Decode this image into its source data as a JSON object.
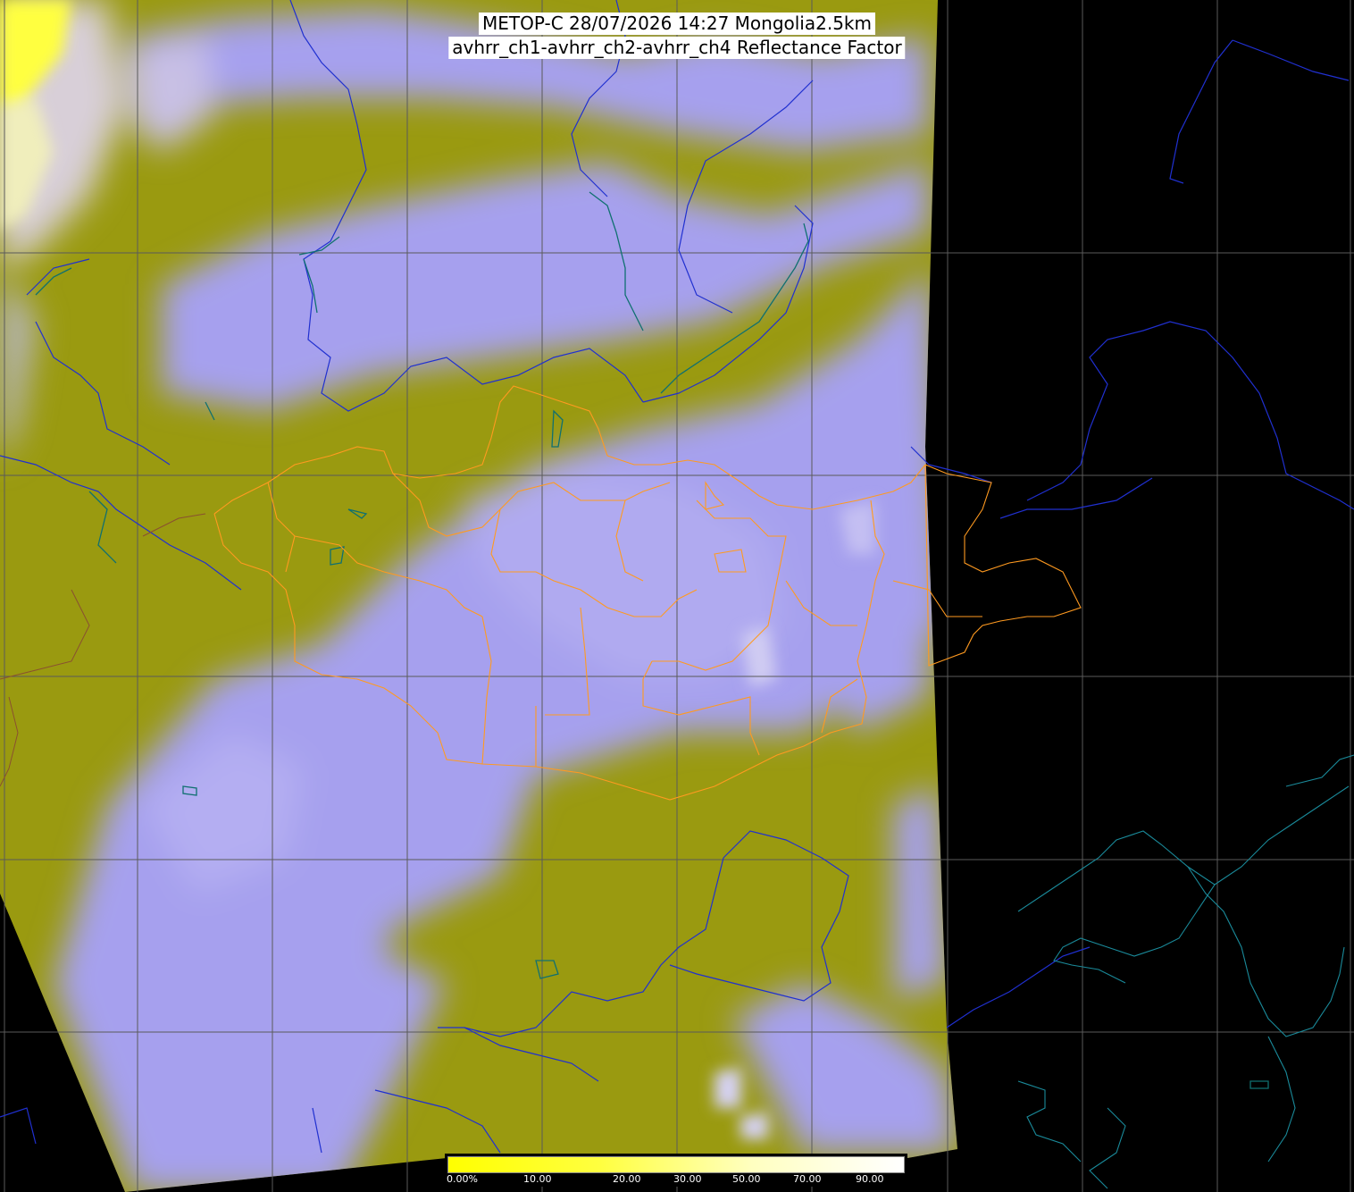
{
  "title": {
    "line1": "METOP-C 28/07/2026 14:27 Mongolia2.5km",
    "line2": "avhrr_ch1-avhrr_ch2-avhrr_ch4 Reflectance Factor"
  },
  "colorbar": {
    "ticks": [
      "0.00%",
      "10.00",
      "20.00",
      "30.00",
      "50.00",
      "70.00",
      "90.00"
    ],
    "gradient_colors": [
      "#ffff00",
      "#ffff40",
      "#ffffc0",
      "#ffffff"
    ]
  },
  "map": {
    "palette": {
      "background": "#000000",
      "swath_olive": "#9a9a10",
      "cloud_lavender": "#a6a0ee",
      "cloud_pale": "#d6d2f4",
      "snow_yellow": "#ffff40",
      "grid": "#5a5a5a",
      "coast_blue": "#2030d0",
      "lake_teal": "#107070",
      "country_orange": "#ff9a20",
      "cyan_coast": "#1a8a9a"
    }
  }
}
